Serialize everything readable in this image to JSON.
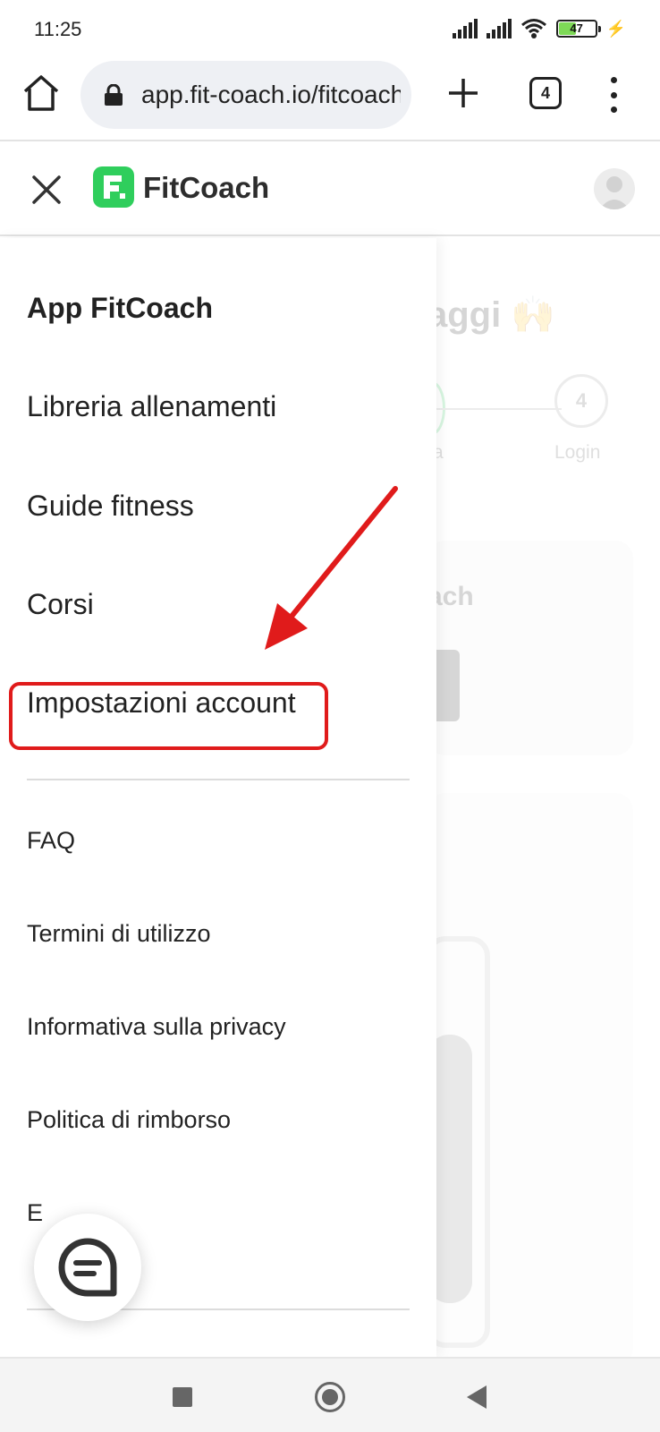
{
  "status_bar": {
    "time": "11:25",
    "battery_level": "47",
    "battery_fraction": 0.47
  },
  "browser": {
    "url": "app.fit-coach.io/fitcoach",
    "tab_count": "4"
  },
  "app_header": {
    "logo_text": "FitCoach"
  },
  "background_page": {
    "heading_fragment": "aggi 🙌",
    "step_4_number": "4",
    "step_3_label_fragment": "a",
    "step_4_label": "Login",
    "card_title_fragment": "ach"
  },
  "drawer": {
    "title": "App FitCoach",
    "items": [
      {
        "label": "Libreria allenamenti"
      },
      {
        "label": "Guide fitness"
      },
      {
        "label": "Corsi"
      },
      {
        "label": "Impostazioni account"
      }
    ],
    "secondary_items": [
      {
        "label": "FAQ"
      },
      {
        "label": "Termini di utilizzo"
      },
      {
        "label": "Informativa sulla privacy"
      },
      {
        "label": "Politica di rimborso"
      },
      {
        "label": "E"
      }
    ]
  },
  "colors": {
    "brand_green": "#2fce5c",
    "highlight_red": "#e01b1b"
  }
}
